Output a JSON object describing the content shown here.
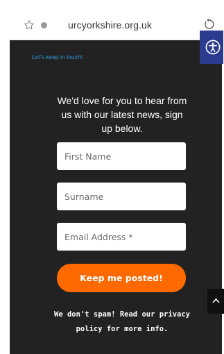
{
  "browser": {
    "url": "urcyorkshire.org.uk",
    "star_icon": "star-outline-icon",
    "info_icon": "info-dot-icon",
    "reload_icon": "reload-icon"
  },
  "newsletter": {
    "heading": "Let's keep in touch!",
    "intro": "We'd love for you to hear from us with our latest news, sign up below.",
    "fields": {
      "first_name_placeholder": "First Name",
      "surname_placeholder": "Surname",
      "email_placeholder": "Email Address *"
    },
    "submit_label": "Keep me posted!",
    "spam_note": "We don't spam! Read our privacy policy for more info."
  },
  "widgets": {
    "accessibility_icon": "accessibility-icon",
    "back_to_top_icon": "chevron-up-icon"
  },
  "colors": {
    "page_bg": "#222222",
    "accent_link": "#2e9ad6",
    "button_orange": "#ff6a00",
    "accessibility_blue": "#2d3b8f"
  }
}
